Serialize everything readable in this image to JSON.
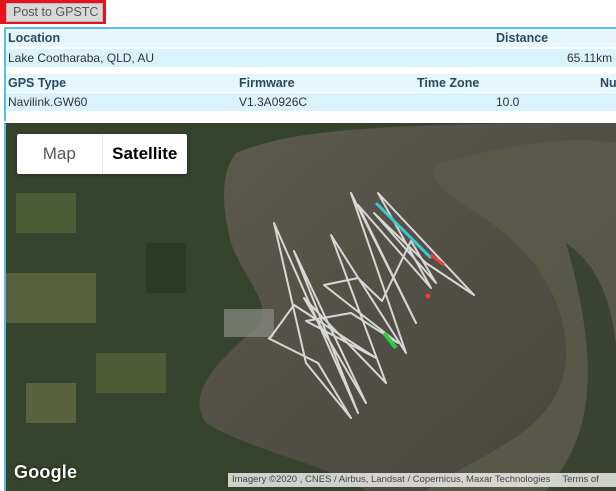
{
  "toolbar": {
    "post_label": "Post to GPSTC"
  },
  "info": {
    "row1_headers": {
      "location": "Location",
      "distance": "Distance"
    },
    "row1_values": {
      "location": "Lake Cootharaba, QLD, AU",
      "distance": "65.11km"
    },
    "row2_headers": {
      "gps_type": "GPS Type",
      "firmware": "Firmware",
      "time_zone": "Time Zone",
      "num": "Nu"
    },
    "row2_values": {
      "gps_type": "Navilink.GW60",
      "firmware": "V1.3A0926C",
      "time_zone": "10.0"
    }
  },
  "map": {
    "type_map": "Map",
    "type_satellite": "Satellite",
    "selected": "Satellite",
    "logo": "Google",
    "attribution": "Imagery ©2020 , CNES / Airbus, Landsat / Copernicus, Maxar Technologies",
    "terms": "Terms of",
    "track_color": "#e6e6e6",
    "highlight_colors": [
      "#3cc8d2",
      "#2ecc40",
      "#e8403a"
    ]
  }
}
